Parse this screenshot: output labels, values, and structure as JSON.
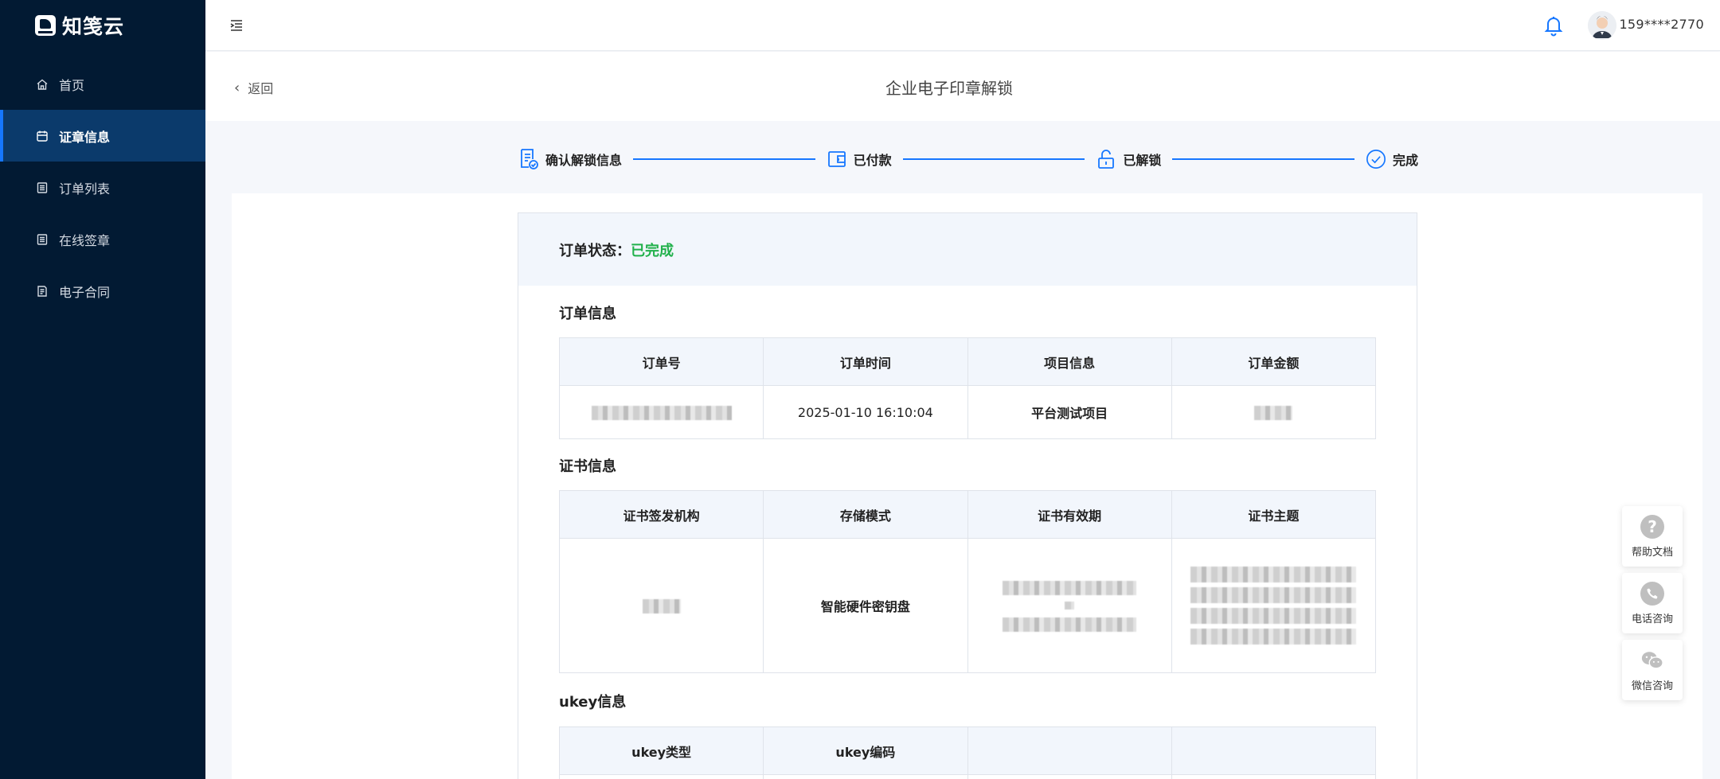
{
  "app": {
    "logo_text": "知笺云"
  },
  "sidebar": {
    "items": [
      {
        "label": "首页",
        "icon": "home-icon",
        "active": false
      },
      {
        "label": "证章信息",
        "icon": "calendar-icon",
        "active": true
      },
      {
        "label": "订单列表",
        "icon": "list-icon",
        "active": false
      },
      {
        "label": "在线签章",
        "icon": "list-icon",
        "active": false
      },
      {
        "label": "电子合同",
        "icon": "contract-icon",
        "active": false
      }
    ]
  },
  "header": {
    "username": "159****2770"
  },
  "page": {
    "back_label": "返回",
    "title": "企业电子印章解锁"
  },
  "steps": [
    {
      "label": "确认解锁信息",
      "icon": "document-check-icon"
    },
    {
      "label": "已付款",
      "icon": "wallet-icon"
    },
    {
      "label": "已解锁",
      "icon": "unlock-icon"
    },
    {
      "label": "完成",
      "icon": "check-circle-icon"
    }
  ],
  "order_status": {
    "label": "订单状态：",
    "value": "已完成",
    "color": "#22b14c"
  },
  "order_info": {
    "title": "订单信息",
    "headers": [
      "订单号",
      "订单时间",
      "项目信息",
      "订单金额"
    ],
    "row": {
      "order_time": "2025-01-10 16:10:04",
      "project": "平台测试项目"
    }
  },
  "cert_info": {
    "title": "证书信息",
    "headers": [
      "证书签发机构",
      "存储模式",
      "证书有效期",
      "证书主题"
    ],
    "row": {
      "storage_mode": "智能硬件密钥盘"
    }
  },
  "ukey_info": {
    "title": "ukey信息",
    "headers": [
      "ukey类型",
      "ukey编码",
      "",
      ""
    ]
  },
  "float_buttons": [
    {
      "label": "帮助文档",
      "icon": "help-icon"
    },
    {
      "label": "电话咨询",
      "icon": "phone-icon"
    },
    {
      "label": "微信咨询",
      "icon": "wechat-icon"
    }
  ],
  "colors": {
    "sidebar_bg": "#021a33",
    "accent": "#1677ff",
    "success": "#22b14c"
  }
}
